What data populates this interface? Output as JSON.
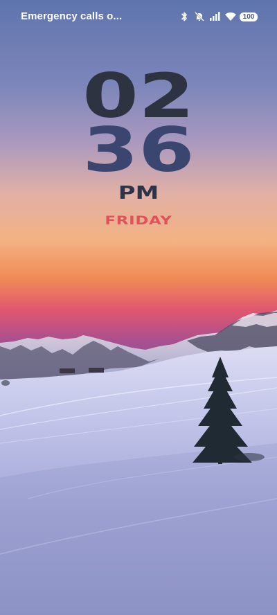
{
  "status_bar": {
    "carrier_text": "Emergency calls o...",
    "battery_level": "100",
    "icons": [
      "bluetooth-icon",
      "silent-mode-icon",
      "cellular-signal-icon",
      "wifi-icon",
      "battery-icon"
    ]
  },
  "clock": {
    "hours": "02",
    "minutes": "36",
    "ampm": "PM",
    "day": "FRIDAY"
  },
  "colors": {
    "hours": "#2e3342",
    "minutes": "#3a4670",
    "ampm": "#2e3448",
    "day": "#e0525a",
    "status_text": "#ffffff"
  },
  "wallpaper": {
    "subject": "sunset-snowy-mountains-with-pine-tree"
  }
}
